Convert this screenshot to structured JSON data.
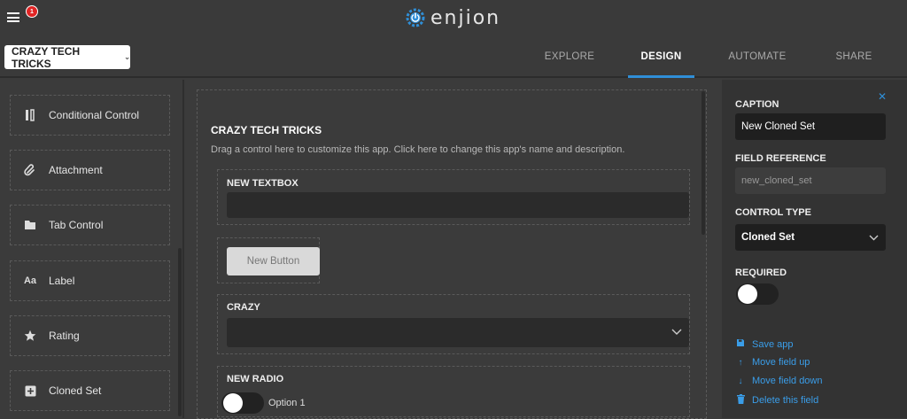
{
  "header": {
    "notification_count": "1",
    "logo_text": "enjion"
  },
  "nav": {
    "app_name": "CRAZY TECH TRICKS",
    "tabs": [
      {
        "label": "EXPLORE",
        "active": false
      },
      {
        "label": "DESIGN",
        "active": true
      },
      {
        "label": "AUTOMATE",
        "active": false
      },
      {
        "label": "SHARE",
        "active": false
      }
    ]
  },
  "controls": [
    {
      "label": "Conditional Control",
      "icon": "conditional-icon"
    },
    {
      "label": "Attachment",
      "icon": "paperclip-icon"
    },
    {
      "label": "Tab Control",
      "icon": "folder-tab-icon"
    },
    {
      "label": "Label",
      "icon": "label-icon",
      "icon_text": "Aa"
    },
    {
      "label": "Rating",
      "icon": "star-icon"
    },
    {
      "label": "Cloned Set",
      "icon": "plus-square-icon"
    }
  ],
  "canvas": {
    "title": "CRAZY TECH TRICKS",
    "subtitle": "Drag a control here to customize this app. Click here to change this app's name and description.",
    "textbox_label": "NEW TEXTBOX",
    "textbox_value": "",
    "button_label": "New Button",
    "dropdown_label": "CRAZY",
    "radio_label": "NEW RADIO",
    "radio_option": "Option 1"
  },
  "properties": {
    "caption_label": "CAPTION",
    "caption_value": "New Cloned Set",
    "field_reference_label": "FIELD REFERENCE",
    "field_reference_value": "new_cloned_set",
    "control_type_label": "CONTROL TYPE",
    "control_type_value": "Cloned Set",
    "required_label": "REQUIRED",
    "required": false,
    "links": [
      {
        "label": "Save app",
        "icon": "save-icon"
      },
      {
        "label": "Move field up",
        "icon": "arrow-up-icon"
      },
      {
        "label": "Move field down",
        "icon": "arrow-down-icon"
      },
      {
        "label": "Delete this field",
        "icon": "trash-icon"
      }
    ]
  },
  "colors": {
    "accent": "#2f8fd8",
    "background": "#3b3b3b",
    "panel": "#333333"
  }
}
